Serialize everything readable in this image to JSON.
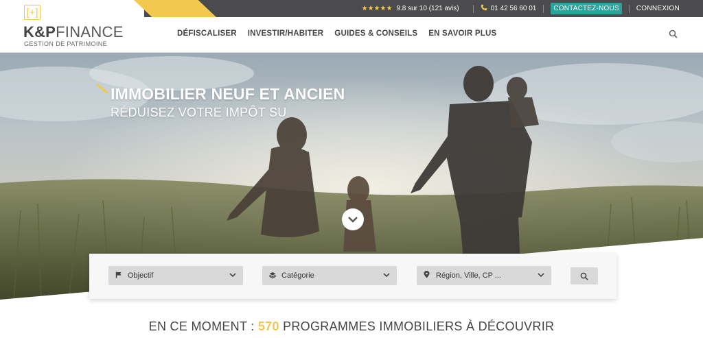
{
  "topbar": {
    "stars": "★★★★★",
    "rating": "9.8 sur 10 (121 avis)",
    "phone": "01 42 56 60 01",
    "contact_label": "CONTACTEZ-NOUS",
    "login_label": "CONNEXION"
  },
  "logo": {
    "mark": "[+]",
    "name_bold": "K&P",
    "name_light": "FINANCE",
    "subtitle": "GESTION DE PATRIMOINE"
  },
  "nav": {
    "items": [
      {
        "label": "DÉFISCALISER"
      },
      {
        "label": "INVESTIR/HABITER"
      },
      {
        "label": "GUIDES & CONSEILS"
      },
      {
        "label": "EN SAVOIR PLUS"
      }
    ]
  },
  "hero": {
    "title": "IMMOBILIER NEUF ET ANCIEN",
    "subtitle": "RÉDUISEZ VOTRE IMPÔT SU"
  },
  "search": {
    "objective_label": "Objectif",
    "category_label": "Catégorie",
    "location_placeholder": "Région, Ville, CP ..."
  },
  "programs": {
    "prefix": "EN CE MOMENT : ",
    "count": "570",
    "suffix": " PROGRAMMES IMMOBILIERS À DÉCOUVRIR"
  },
  "colors": {
    "accent_yellow": "#f2c94c",
    "topbar_dark": "#4b4b4d",
    "contact_teal": "#2aa39a"
  }
}
